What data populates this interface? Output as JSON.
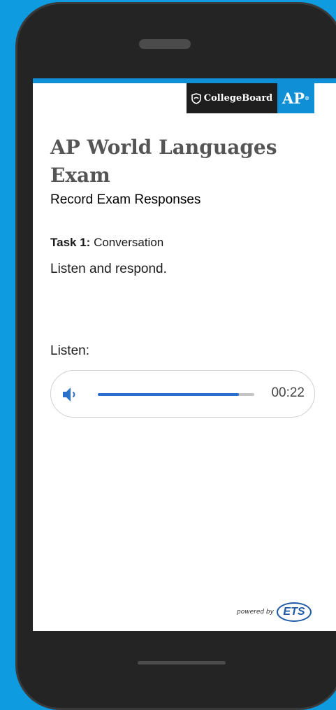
{
  "header": {
    "collegeboard_label": "CollegeBoard",
    "ap_label": "AP",
    "ap_mark": "®"
  },
  "content": {
    "title": "AP World Languages Exam",
    "subtitle": "Record Exam Responses",
    "task_label": "Task 1:",
    "task_name": "Conversation",
    "instruction": "Listen and respond.",
    "listen_label": "Listen:"
  },
  "player": {
    "progress_fraction": 0.9,
    "time": "00:22",
    "icon": "volume-icon"
  },
  "footer": {
    "powered_by": "powered by",
    "ets_label": "ETS"
  },
  "colors": {
    "background": "#0e9be0",
    "accent": "#0f8fd6",
    "progress": "#2a6fc9"
  }
}
